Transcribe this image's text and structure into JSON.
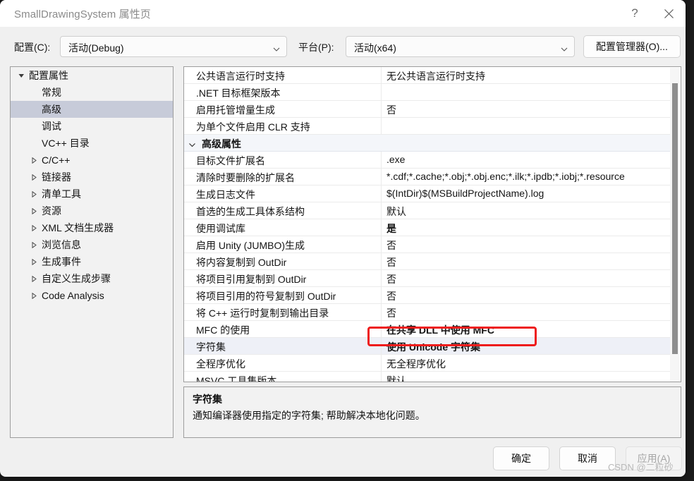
{
  "window": {
    "title": "SmallDrawingSystem 属性页",
    "help_icon": "help-question-icon",
    "close_icon": "close-icon"
  },
  "config_bar": {
    "config_label": "配置(C):",
    "config_value": "活动(Debug)",
    "platform_label": "平台(P):",
    "platform_value": "活动(x64)",
    "config_manager_button": "配置管理器(O)..."
  },
  "tree": {
    "items": [
      {
        "label": "配置属性",
        "indent": 0,
        "twisty": "expanded",
        "selected": false
      },
      {
        "label": "常规",
        "indent": 1,
        "twisty": "none",
        "selected": false
      },
      {
        "label": "高级",
        "indent": 1,
        "twisty": "none",
        "selected": true
      },
      {
        "label": "调试",
        "indent": 1,
        "twisty": "none",
        "selected": false
      },
      {
        "label": "VC++ 目录",
        "indent": 1,
        "twisty": "none",
        "selected": false
      },
      {
        "label": "C/C++",
        "indent": 1,
        "twisty": "collapsed",
        "selected": false
      },
      {
        "label": "链接器",
        "indent": 1,
        "twisty": "collapsed",
        "selected": false
      },
      {
        "label": "清单工具",
        "indent": 1,
        "twisty": "collapsed",
        "selected": false
      },
      {
        "label": "资源",
        "indent": 1,
        "twisty": "collapsed",
        "selected": false
      },
      {
        "label": "XML 文档生成器",
        "indent": 1,
        "twisty": "collapsed",
        "selected": false
      },
      {
        "label": "浏览信息",
        "indent": 1,
        "twisty": "collapsed",
        "selected": false
      },
      {
        "label": "生成事件",
        "indent": 1,
        "twisty": "collapsed",
        "selected": false
      },
      {
        "label": "自定义生成步骤",
        "indent": 1,
        "twisty": "collapsed",
        "selected": false
      },
      {
        "label": "Code Analysis",
        "indent": 1,
        "twisty": "collapsed",
        "selected": false
      }
    ]
  },
  "grid": {
    "rows": [
      {
        "type": "prop",
        "name": "公共语言运行时支持",
        "value": "无公共语言运行时支持",
        "bold": false,
        "selected": false
      },
      {
        "type": "prop",
        "name": ".NET 目标框架版本",
        "value": "",
        "bold": false,
        "selected": false
      },
      {
        "type": "prop",
        "name": "启用托管增量生成",
        "value": "否",
        "bold": false,
        "selected": false
      },
      {
        "type": "prop",
        "name": "为单个文件启用 CLR 支持",
        "value": "",
        "bold": false,
        "selected": false
      },
      {
        "type": "group",
        "name": "高级属性",
        "value": "",
        "bold": true,
        "selected": false
      },
      {
        "type": "prop",
        "name": "目标文件扩展名",
        "value": ".exe",
        "bold": false,
        "selected": false
      },
      {
        "type": "prop",
        "name": "清除时要删除的扩展名",
        "value": "*.cdf;*.cache;*.obj;*.obj.enc;*.ilk;*.ipdb;*.iobj;*.resource",
        "bold": false,
        "selected": false
      },
      {
        "type": "prop",
        "name": "生成日志文件",
        "value": "$(IntDir)$(MSBuildProjectName).log",
        "bold": false,
        "selected": false
      },
      {
        "type": "prop",
        "name": "首选的生成工具体系结构",
        "value": "默认",
        "bold": false,
        "selected": false
      },
      {
        "type": "prop",
        "name": "使用调试库",
        "value": "是",
        "bold": true,
        "selected": false
      },
      {
        "type": "prop",
        "name": "启用 Unity (JUMBO)生成",
        "value": "否",
        "bold": false,
        "selected": false
      },
      {
        "type": "prop",
        "name": "将内容复制到 OutDir",
        "value": "否",
        "bold": false,
        "selected": false
      },
      {
        "type": "prop",
        "name": "将项目引用复制到 OutDir",
        "value": "否",
        "bold": false,
        "selected": false
      },
      {
        "type": "prop",
        "name": "将项目引用的符号复制到 OutDir",
        "value": "否",
        "bold": false,
        "selected": false
      },
      {
        "type": "prop",
        "name": "将 C++ 运行时复制到输出目录",
        "value": "否",
        "bold": false,
        "selected": false
      },
      {
        "type": "prop",
        "name": "MFC 的使用",
        "value": "在共享 DLL 中使用 MFC",
        "bold": true,
        "selected": false
      },
      {
        "type": "prop",
        "name": "字符集",
        "value": "使用 Unicode 字符集",
        "bold": true,
        "selected": true
      },
      {
        "type": "prop",
        "name": "全程序优化",
        "value": "无全程序优化",
        "bold": false,
        "selected": false
      },
      {
        "type": "prop",
        "name": "MSVC 工具集版本",
        "value": "默认",
        "bold": false,
        "selected": false
      }
    ],
    "highlight_color": "#ee1c1c"
  },
  "description": {
    "title": "字符集",
    "body": "通知编译器使用指定的字符集; 帮助解决本地化问题。"
  },
  "footer": {
    "ok": "确定",
    "cancel": "取消",
    "apply": "应用(A)"
  },
  "watermark": "CSDN @二粒砂"
}
